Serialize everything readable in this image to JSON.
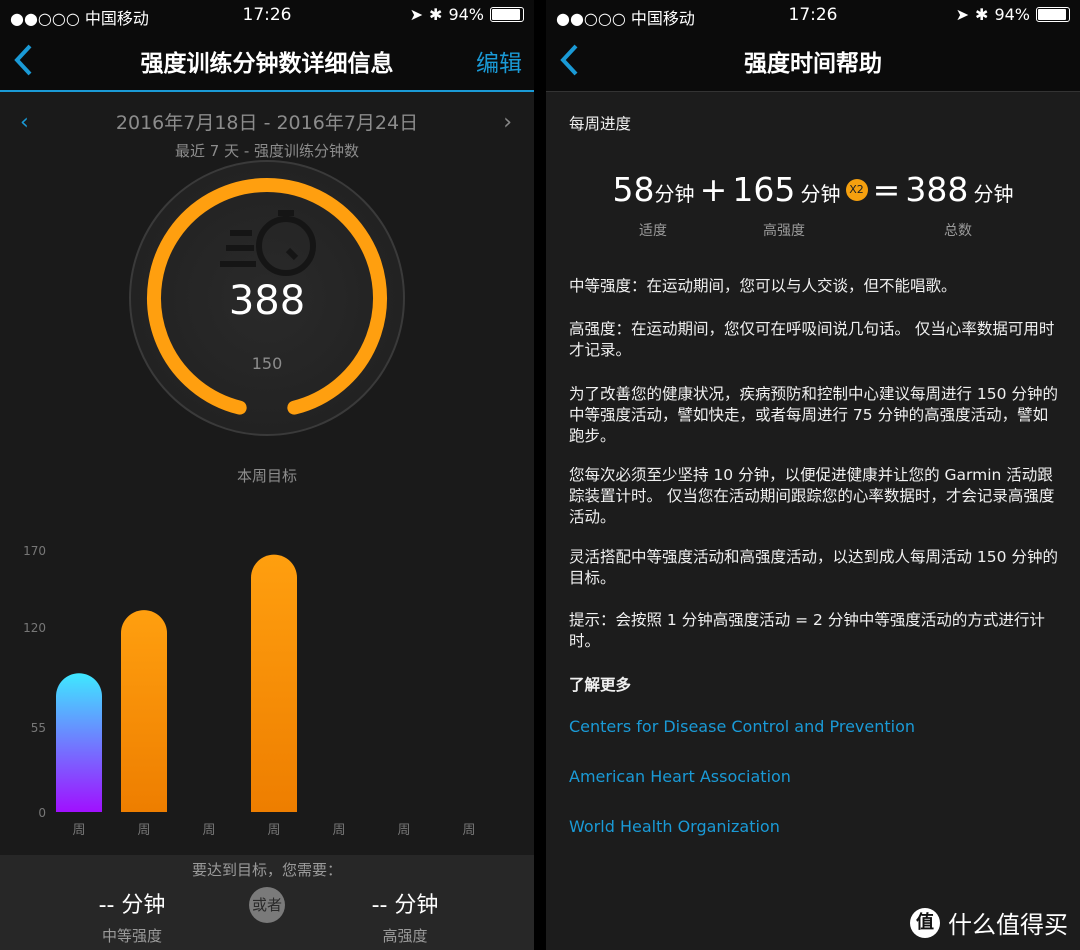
{
  "status": {
    "carrier": "●●○○○ 中国移动",
    "time": "17:26",
    "battery": "94%",
    "battery_level": 0.94
  },
  "left": {
    "nav": {
      "title": "强度训练分钟数详细信息",
      "edit": "编辑"
    },
    "date_range": "2016年7月18日 - 2016年7月24日",
    "subtitle": "最近 7 天 - 强度训练分钟数",
    "ring": {
      "value": "388",
      "goal_value": "150",
      "goal_label": "本周目标",
      "icon": "stopwatch-icon",
      "color": "#ff9f0f"
    },
    "chart_data": {
      "type": "bar",
      "categories": [
        "周",
        "周",
        "周",
        "周",
        "周",
        "周",
        "周"
      ],
      "values": [
        90,
        131,
        0,
        167,
        0,
        0,
        0
      ],
      "yticks": [
        "0",
        "55",
        "120",
        "170"
      ],
      "ylim": [
        0,
        170
      ],
      "colors": {
        "first": [
          "#3fe8ff",
          "#a010ff"
        ],
        "rest": [
          "#ff9f0f",
          "#ee7e00"
        ]
      }
    },
    "bottom": {
      "need": "要达到目标，您需要：",
      "moderate_value": "-- 分钟",
      "moderate_label": "中等强度",
      "or": "或者",
      "vigorous_value": "-- 分钟",
      "vigorous_label": "高强度"
    }
  },
  "right": {
    "nav": {
      "title": "强度时间帮助"
    },
    "section": "每周进度",
    "formula": {
      "moderate": "58",
      "unit": "分钟",
      "plus": "+",
      "vigorous": "165",
      "x2": "X2",
      "eq": "=",
      "total": "388",
      "moderate_label": "适度",
      "vigorous_label": "高强度",
      "total_label": "总数"
    },
    "paragraphs": [
      "中等强度：在运动期间，您可以与人交谈，但不能唱歌。",
      "高强度：在运动期间，您仅可在呼吸间说几句话。 仅当心率数据可用时才记录。",
      "为了改善您的健康状况，疾病预防和控制中心建议每周进行 150 分钟的中等强度活动，譬如快走，或者每周进行 75 分钟的高强度活动，譬如跑步。",
      "您每次必须至少坚持 10 分钟，以便促进健康并让您的 Garmin 活动跟踪装置计时。 仅当您在活动期间跟踪您的心率数据时，才会记录高强度活动。",
      "灵活搭配中等强度活动和高强度活动，以达到成人每周活动 150 分钟的目标。",
      "提示：会按照 1 分钟高强度活动 = 2 分钟中等强度活动的方式进行计时。"
    ],
    "learn_more": "了解更多",
    "links": [
      "Centers for Disease Control and Prevention",
      "American Heart Association",
      "World Health Organization"
    ],
    "watermark": "什么值得买"
  },
  "accent": "#1a9ad6"
}
